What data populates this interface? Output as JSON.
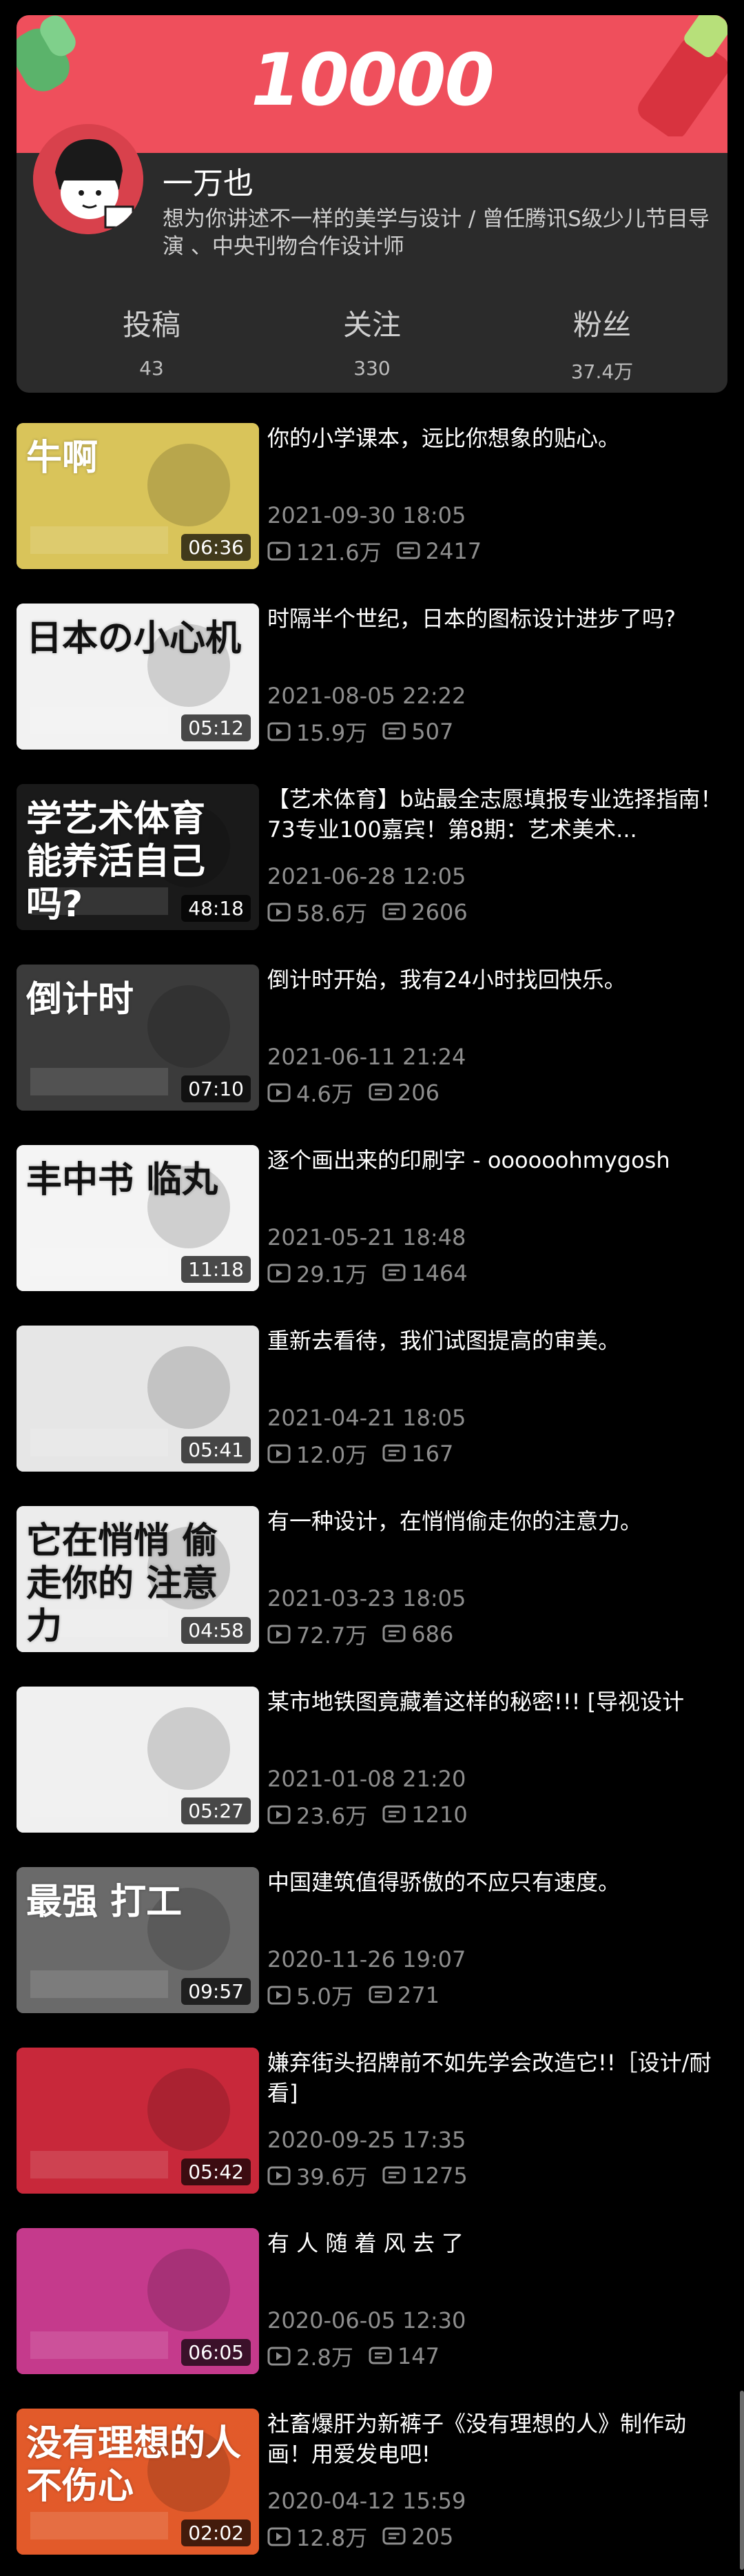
{
  "profile": {
    "banner_number": "10000",
    "name": "一万也",
    "bio": "想为你讲述不一样的美学与设计 / 曾任腾讯S级少儿节目导演 、中央刊物合作设计师",
    "stats": [
      {
        "label": "投稿",
        "value": "43"
      },
      {
        "label": "关注",
        "value": "330"
      },
      {
        "label": "粉丝",
        "value": "37.4万"
      }
    ]
  },
  "videos": [
    {
      "title": "你的小学课本，远比你想象的贴心。",
      "date": "2021-09-30 18:05",
      "plays": "121.6万",
      "comments": "2417",
      "duration": "06:36",
      "thumb_text": "牛啊",
      "thumb_color": "#d9c45a"
    },
    {
      "title": "时隔半个世纪，日本的图标设计进步了吗?",
      "date": "2021-08-05 22:22",
      "plays": "15.9万",
      "comments": "507",
      "duration": "05:12",
      "thumb_text": "日本の小心机",
      "thumb_color": "#f2f2f2"
    },
    {
      "title": "【艺术体育】b站最全志愿填报专业选择指南！73专业100嘉宾！第8期：艺术美术...",
      "date": "2021-06-28 12:05",
      "plays": "58.6万",
      "comments": "2606",
      "duration": "48:18",
      "thumb_text": "学艺术体育 能养活自己吗?",
      "thumb_color": "#1a1a1a"
    },
    {
      "title": "倒计时开始，我有24小时找回快乐。",
      "date": "2021-06-11 21:24",
      "plays": "4.6万",
      "comments": "206",
      "duration": "07:10",
      "thumb_text": "倒计时",
      "thumb_color": "#3b3b3b"
    },
    {
      "title": "逐个画出来的印刷字 - oooooohmygosh",
      "date": "2021-05-21 18:48",
      "plays": "29.1万",
      "comments": "1464",
      "duration": "11:18",
      "thumb_text": "丰中书 临丸",
      "thumb_color": "#f4f4f4"
    },
    {
      "title": "重新去看待，我们试图提高的审美。",
      "date": "2021-04-21 18:05",
      "plays": "12.0万",
      "comments": "167",
      "duration": "05:41",
      "thumb_text": "",
      "thumb_color": "#e6e6e6"
    },
    {
      "title": "有一种设计，在悄悄偷走你的注意力。",
      "date": "2021-03-23 18:05",
      "plays": "72.7万",
      "comments": "686",
      "duration": "04:58",
      "thumb_text": "它在悄悄 偷走你的 注意力",
      "thumb_color": "#ececec"
    },
    {
      "title": "某市地铁图竟藏着这样的秘密!!! [导视设计",
      "date": "2021-01-08 21:20",
      "plays": "23.6万",
      "comments": "1210",
      "duration": "05:27",
      "thumb_text": "",
      "thumb_color": "#f0f0f0"
    },
    {
      "title": "中国建筑值得骄傲的不应只有速度。",
      "date": "2020-11-26 19:07",
      "plays": "5.0万",
      "comments": "271",
      "duration": "09:57",
      "thumb_text": "最强 打工",
      "thumb_color": "#6a6a6a"
    },
    {
      "title": "嫌弃街头招牌前不如先学会改造它!!［设计/耐看]",
      "date": "2020-09-25 17:35",
      "plays": "39.6万",
      "comments": "1275",
      "duration": "05:42",
      "thumb_text": "",
      "thumb_color": "#c8283a"
    },
    {
      "title": "有 人 随 着 风 去 了",
      "date": "2020-06-05 12:30",
      "plays": "2.8万",
      "comments": "147",
      "duration": "06:05",
      "thumb_text": "",
      "thumb_color": "#c53a8c"
    },
    {
      "title": "社畜爆肝为新裤子《没有理想的人》制作动画！用爱发电吧!",
      "date": "2020-04-12 15:59",
      "plays": "12.8万",
      "comments": "205",
      "duration": "02:02",
      "thumb_text": "没有理想的人不伤心",
      "thumb_color": "#e25a2a"
    }
  ]
}
